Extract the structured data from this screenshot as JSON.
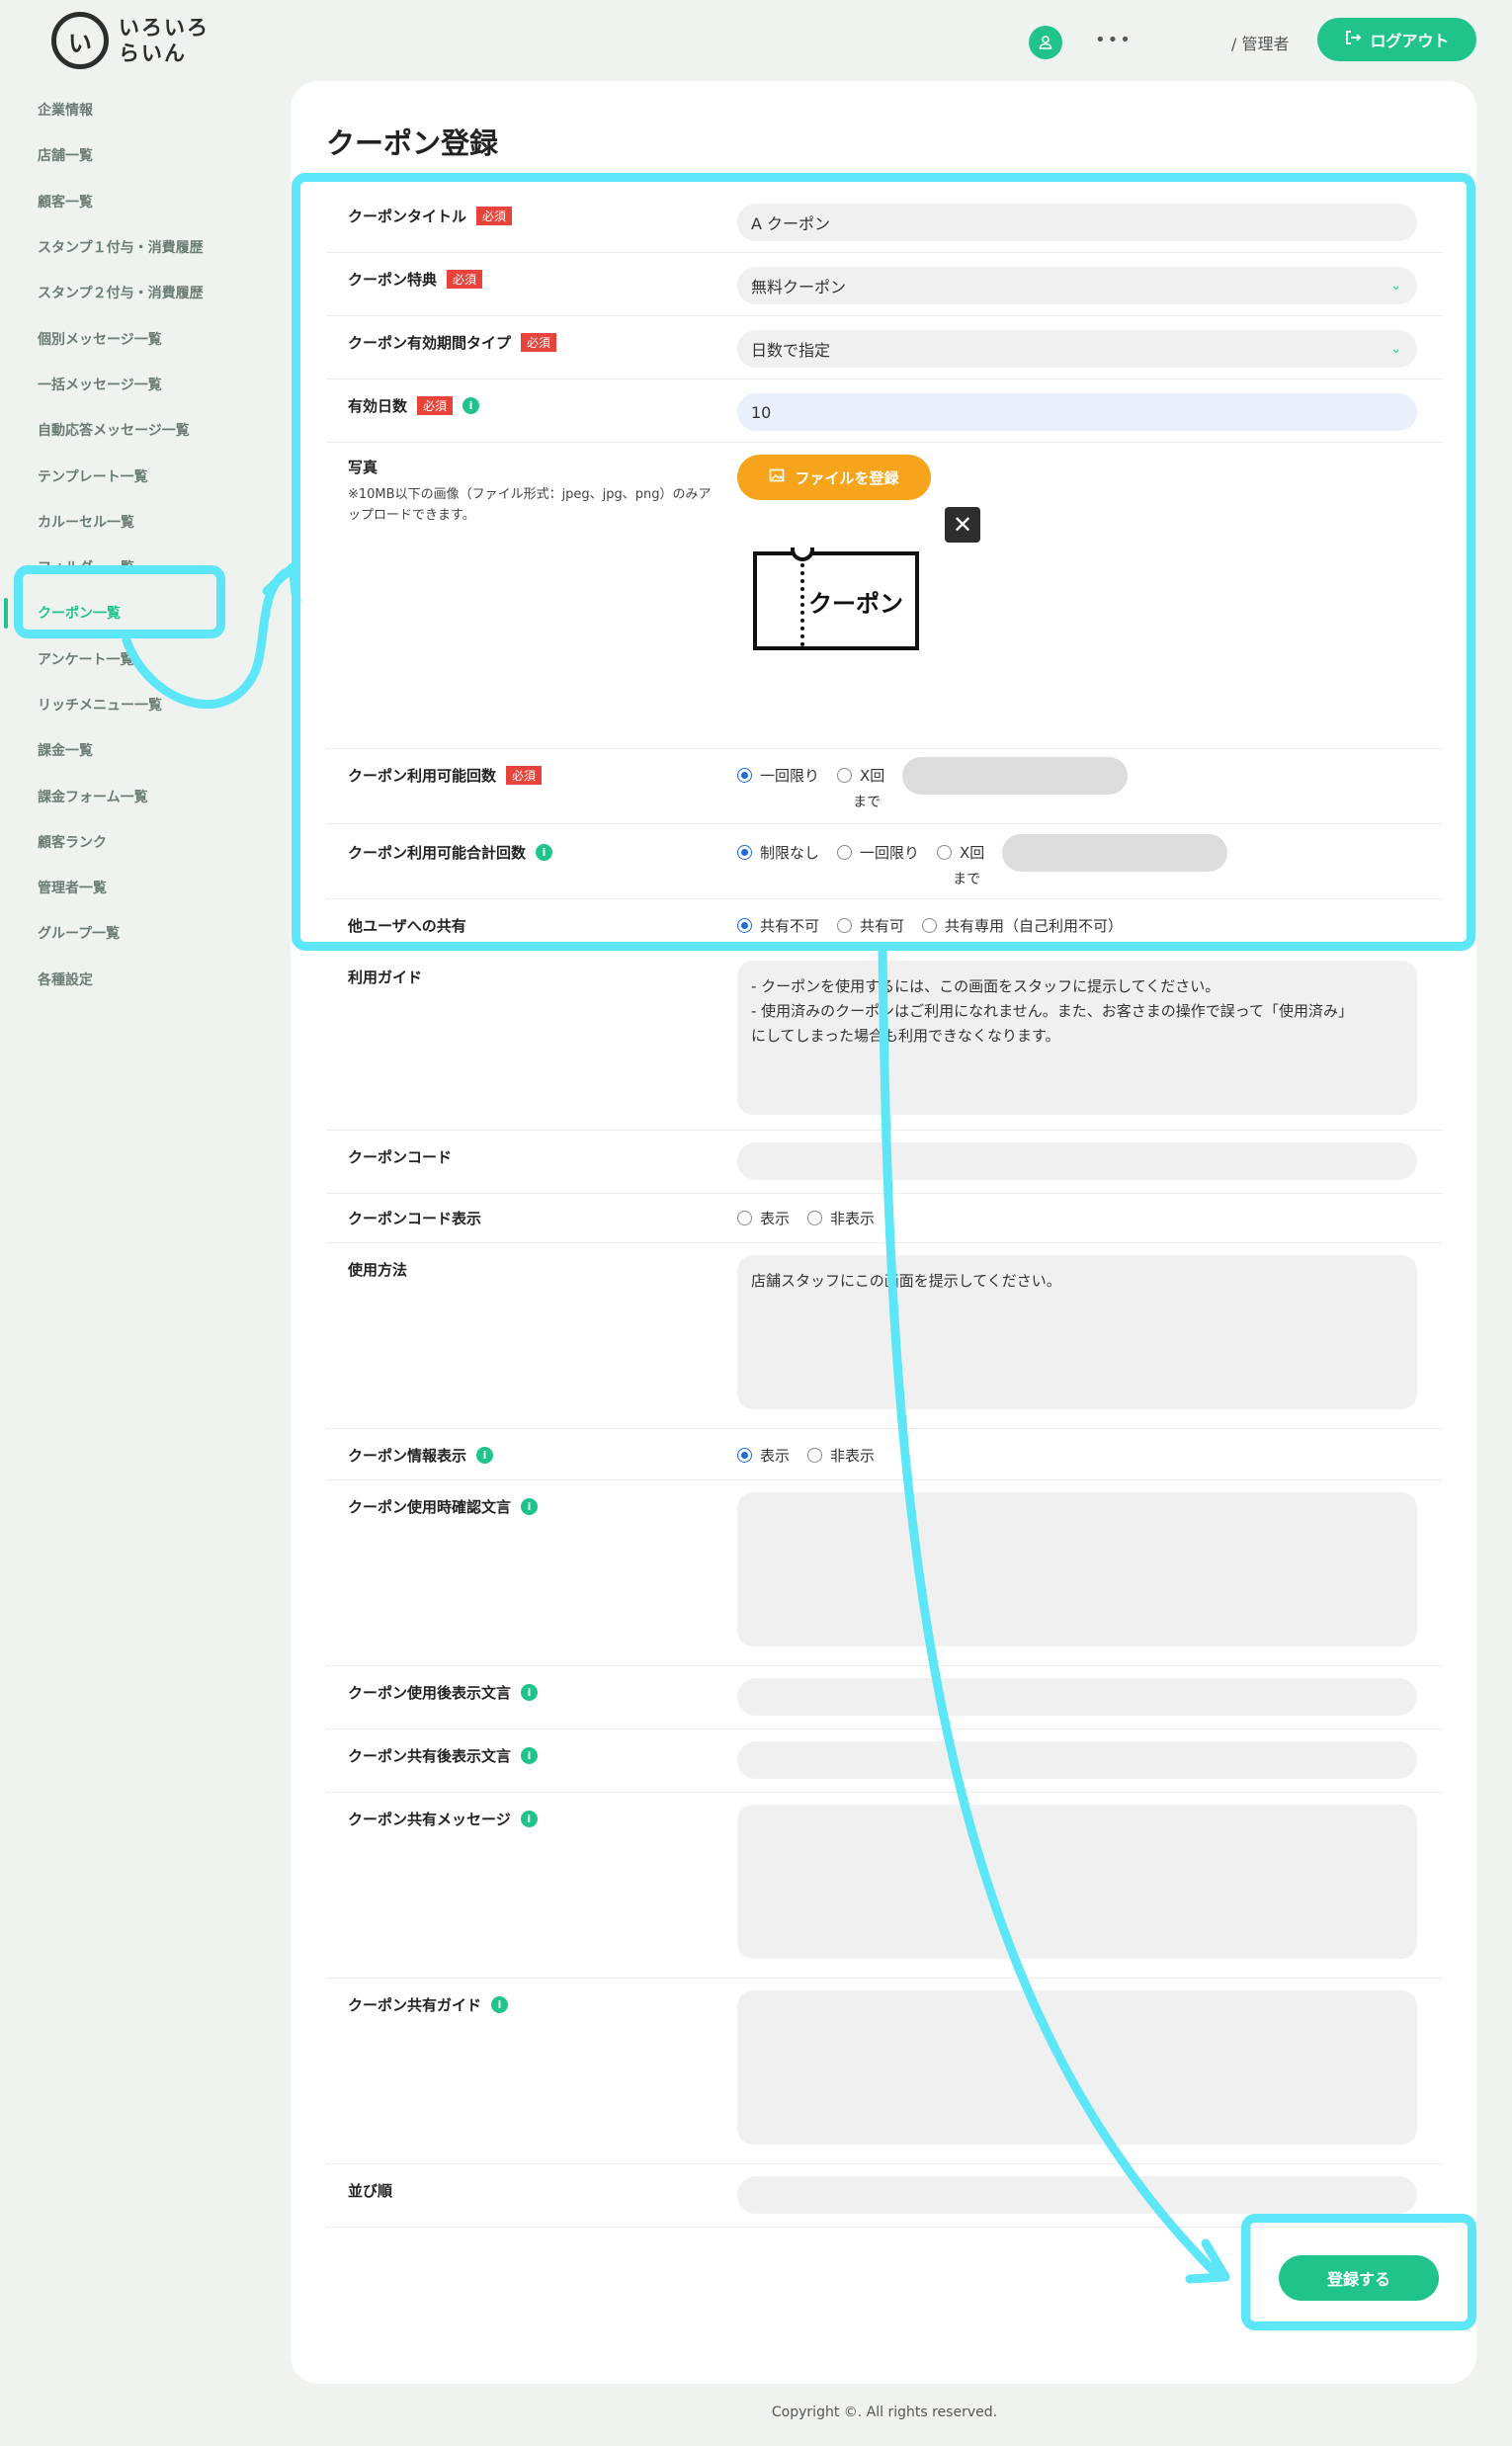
{
  "header": {
    "logo_mark": "い",
    "logo_line1": "いろいろ",
    "logo_line2": "らいん",
    "user_icon": "user-icon",
    "more": "•••",
    "admin": "/ 管理者",
    "logout": "ログアウト"
  },
  "sidebar": {
    "items": [
      {
        "label": "企業情報"
      },
      {
        "label": "店舗一覧"
      },
      {
        "label": "顧客一覧"
      },
      {
        "label": "スタンプ１付与・消費履歴"
      },
      {
        "label": "スタンプ２付与・消費履歴"
      },
      {
        "label": "個別メッセージ一覧"
      },
      {
        "label": "一括メッセージ一覧"
      },
      {
        "label": "自動応答メッセージ一覧"
      },
      {
        "label": "テンプレート一覧"
      },
      {
        "label": "カルーセル一覧"
      },
      {
        "label": "フォルダー一覧"
      },
      {
        "label": "クーポン一覧"
      },
      {
        "label": "アンケート一覧"
      },
      {
        "label": "リッチメニュー一覧"
      },
      {
        "label": "課金一覧"
      },
      {
        "label": "課金フォーム一覧"
      },
      {
        "label": "顧客ランク"
      },
      {
        "label": "管理者一覧"
      },
      {
        "label": "グループ一覧"
      },
      {
        "label": "各種設定"
      }
    ]
  },
  "page": {
    "title": "クーポン登録",
    "required": "必須"
  },
  "form": {
    "coupon_title": {
      "label": "クーポンタイトル",
      "value": "A クーポン"
    },
    "benefit": {
      "label": "クーポン特典",
      "value": "無料クーポン"
    },
    "period_type": {
      "label": "クーポン有効期間タイプ",
      "value": "日数で指定"
    },
    "valid_days": {
      "label": "有効日数",
      "value": "10"
    },
    "photo": {
      "label": "写真",
      "note": "※10MB以下の画像（ファイル形式：jpeg、jpg、png）のみアップロードできます。",
      "button": "ファイルを登録",
      "image_text": "クーポン"
    },
    "usage_count": {
      "label": "クーポン利用可能回数",
      "opt1": "一回限り",
      "opt2": "X回",
      "sub": "まで"
    },
    "total_count": {
      "label": "クーポン利用可能合計回数",
      "opt1": "制限なし",
      "opt2": "一回限り",
      "opt3": "X回",
      "sub": "まで"
    },
    "share": {
      "label": "他ユーザへの共有",
      "opt1": "共有不可",
      "opt2": "共有可",
      "opt3": "共有専用（自己利用不可）"
    },
    "guide": {
      "label": "利用ガイド",
      "line1": "- クーポンを使用するには、この画面をスタッフに提示してください。",
      "line2": "- 使用済みのクーポンはご利用になれません。また、お客さまの操作で誤って「使用済み」",
      "line3": "にしてしまった場合も利用できなくなります。"
    },
    "code": {
      "label": "クーポンコード"
    },
    "code_display": {
      "label": "クーポンコード表示",
      "opt1": "表示",
      "opt2": "非表示"
    },
    "how_to_use": {
      "label": "使用方法",
      "value": "店舗スタッフにこの画面を提示してください。"
    },
    "info_display": {
      "label": "クーポン情報表示",
      "opt1": "表示",
      "opt2": "非表示"
    },
    "confirm_text": {
      "label": "クーポン使用時確認文言"
    },
    "after_use_text": {
      "label": "クーポン使用後表示文言"
    },
    "after_share_text": {
      "label": "クーポン共有後表示文言"
    },
    "share_message": {
      "label": "クーポン共有メッセージ"
    },
    "share_guide": {
      "label": "クーポン共有ガイド"
    },
    "sort_order": {
      "label": "並び順"
    }
  },
  "submit": "登録する",
  "footer": "Copyright ©. All rights reserved.",
  "colors": {
    "accent": "#20c48a",
    "highlight": "#5ce6f7",
    "required": "#e8433a",
    "upload": "#f7a41d"
  }
}
